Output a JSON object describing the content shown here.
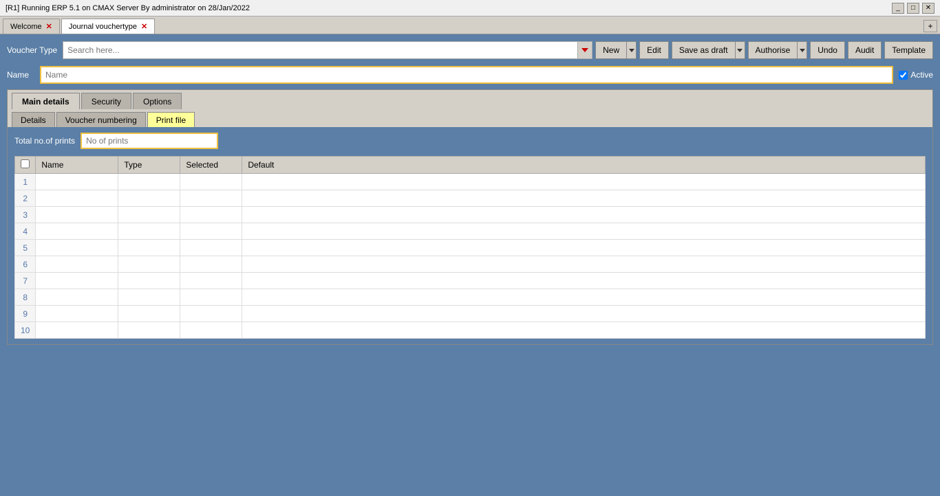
{
  "titleBar": {
    "title": "[R1] Running ERP 5.1 on CMAX Server By administrator on 28/Jan/2022",
    "controls": [
      "_",
      "□",
      "✕"
    ]
  },
  "tabs": [
    {
      "label": "Welcome",
      "closable": true,
      "active": false
    },
    {
      "label": "Journal vouchertype",
      "closable": true,
      "active": true
    }
  ],
  "tabAdd": "+",
  "toolbar": {
    "voucherTypeLabel": "Voucher Type",
    "searchPlaceholder": "Search here...",
    "newBtn": "New",
    "editBtn": "Edit",
    "saveAsDraftBtn": "Save as draft",
    "authoriseBtn": "Authorise",
    "undoBtn": "Undo",
    "auditBtn": "Audit",
    "templateBtn": "Template"
  },
  "nameRow": {
    "label": "Name",
    "placeholder": "Name",
    "activeLabel": "Active",
    "activeChecked": true
  },
  "mainTabs": [
    {
      "label": "Main details",
      "active": true
    },
    {
      "label": "Security",
      "active": false
    },
    {
      "label": "Options",
      "active": false
    }
  ],
  "subTabs": [
    {
      "label": "Details",
      "active": false
    },
    {
      "label": "Voucher numbering",
      "active": false
    },
    {
      "label": "Print file",
      "active": true
    }
  ],
  "printFile": {
    "totalPrintsLabel": "Total no.of prints",
    "totalPrintsPlaceholder": "No of prints",
    "tableHeaders": {
      "checkbox": "",
      "name": "Name",
      "type": "Type",
      "selected": "Selected",
      "default": "Default"
    },
    "rows": [
      1,
      2,
      3,
      4,
      5,
      6,
      7,
      8,
      9,
      10
    ]
  }
}
